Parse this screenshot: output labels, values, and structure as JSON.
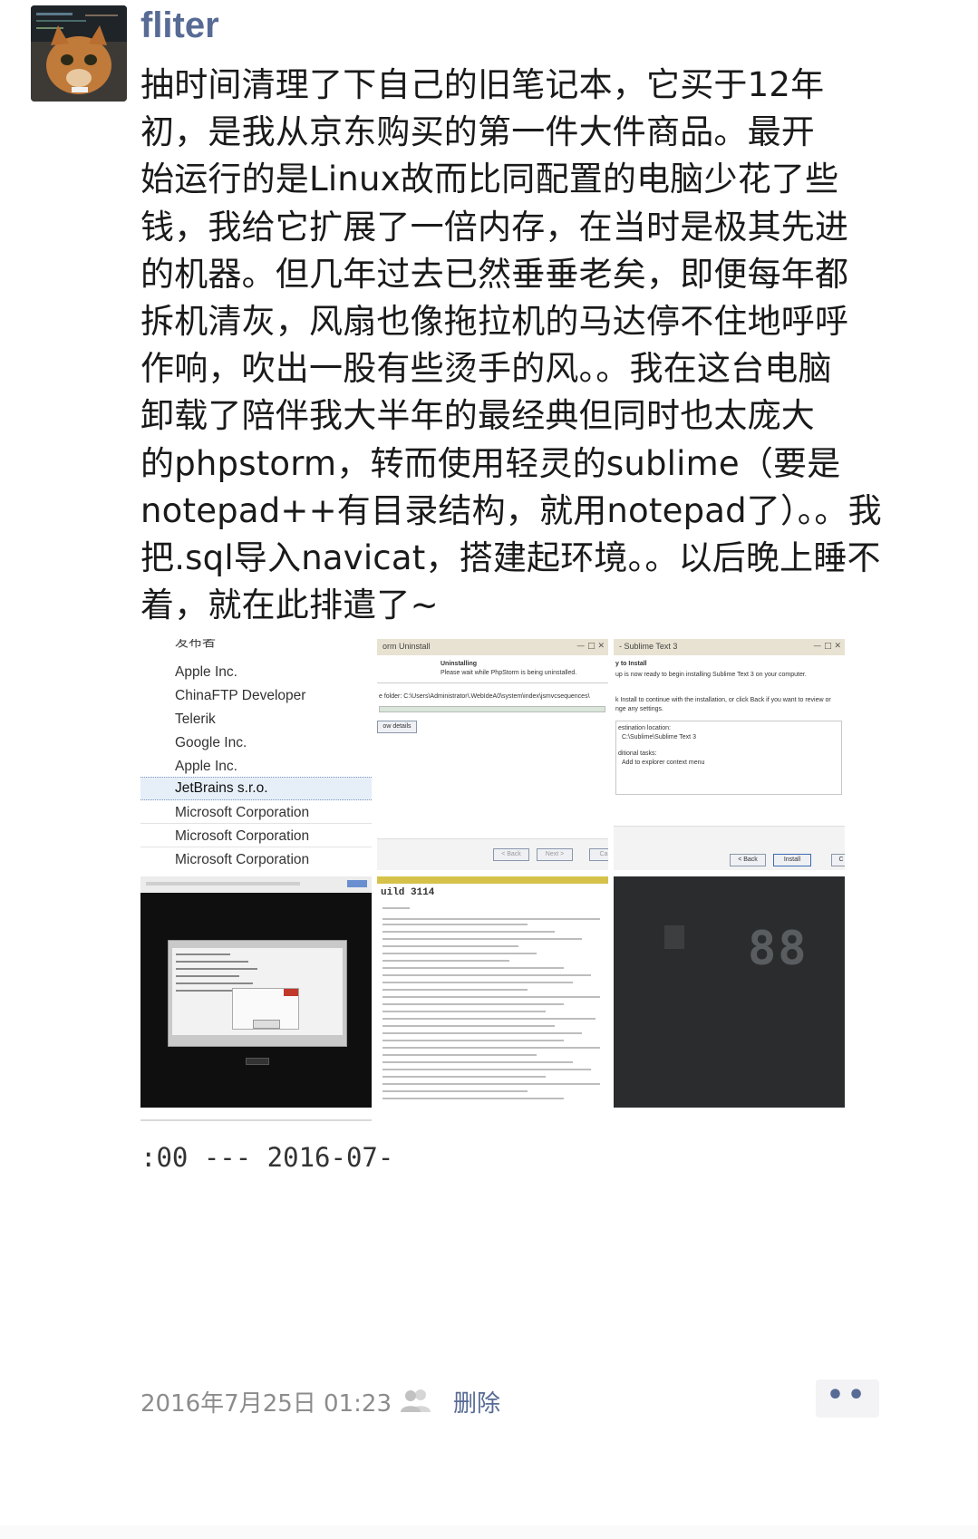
{
  "post": {
    "username": "fliter",
    "body": "抽时间清理了下自己的旧笔记本，它买于12年\n初，是我从京东购买的第一件大件商品。最开\n始运行的是Linux故而比同配置的电脑少花了些\n钱，我给它扩展了一倍内存，在当时是极其先进\n的机器。但几年过去已然垂垂老矣，即便每年都\n拆机清灰，风扇也像拖拉机的马达停不住地呼呼\n作响，吹出一股有些烫手的风。。我在这台电脑\n卸载了陪伴我大半年的最经典但同时也太庞大\n的phpstorm，转而使用轻灵的sublime（要是\nnotepad++有目录结构，就用notepad了）。。我\n把.sql导入navicat，搭建起环境。。以后晚上睡不\n着，就在此排遣了~",
    "timestamp": "2016年7月25日 01:23",
    "delete_label": "删除",
    "more_label": "••"
  },
  "images": {
    "publishers": {
      "header": "发布者",
      "items": [
        "Apple Inc.",
        "ChinaFTP Developer",
        "Telerik",
        "Google Inc.",
        "Apple Inc."
      ],
      "selected": "JetBrains s.r.o.",
      "after": [
        "Microsoft Corporation",
        "Microsoft Corporation",
        "Microsoft Corporation"
      ]
    },
    "uninstall": {
      "title": "orm Uninstall",
      "heading": "Uninstalling",
      "subheading": "Please wait while PhpStorm is being uninstalled.",
      "folder": "e folder: C:\\Users\\Administrator\\.WebIdeA0\\system\\index\\jsmvcsequences\\",
      "details_btn": "ow details",
      "back_btn": "< Back",
      "next_btn": "Next >",
      "cancel_btn": "Ca"
    },
    "sublime": {
      "title": "- Sublime Text 3",
      "heading": "y to Install",
      "line1": "up is now ready to begin installing Sublime Text 3 on your computer.",
      "line2": "k Install to continue with the installation, or click Back if you want to review or",
      "line3": "nge any settings.",
      "dest_label": "estination location:",
      "dest_value": "C:\\Sublime\\Sublime Text 3",
      "tasks_label": "ditional tasks:",
      "tasks_value": "Add to explorer context menu",
      "back_btn": "< Back",
      "install_btn": "Install",
      "cancel_btn": "C"
    },
    "changelog": {
      "title": "uild 3114"
    },
    "clock": {
      "digits": "88"
    },
    "cut_text": ":00 --- 2016-07-"
  }
}
